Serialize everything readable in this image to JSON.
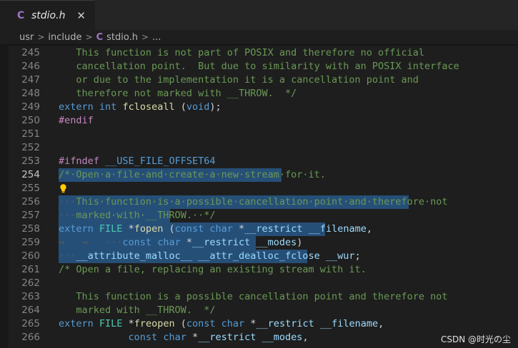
{
  "tab": {
    "icon": "c-file-icon",
    "icon_glyph": "C",
    "label": "stdio.h",
    "close_glyph": "✕"
  },
  "breadcrumb": {
    "parts": [
      "usr",
      "include",
      "stdio.h",
      "..."
    ],
    "sep": ">",
    "c_glyph": "C"
  },
  "watermark": "CSDN @时光の尘",
  "lines": [
    {
      "n": "245",
      "segs": [
        {
          "c": "cmt",
          "t": "   This function is not part of POSIX and therefore no official"
        }
      ]
    },
    {
      "n": "246",
      "segs": [
        {
          "c": "cmt",
          "t": "   cancellation point.  But due to similarity with an POSIX interface"
        }
      ]
    },
    {
      "n": "247",
      "segs": [
        {
          "c": "cmt",
          "t": "   or due to the implementation it is a cancellation point and"
        }
      ]
    },
    {
      "n": "248",
      "segs": [
        {
          "c": "cmt",
          "t": "   therefore not marked with __THROW.  */"
        }
      ]
    },
    {
      "n": "249",
      "segs": [
        {
          "c": "kw",
          "t": "extern"
        },
        {
          "c": "pl",
          "t": " "
        },
        {
          "c": "kw",
          "t": "int"
        },
        {
          "c": "pl",
          "t": " "
        },
        {
          "c": "fn",
          "t": "fcloseall"
        },
        {
          "c": "pl",
          "t": " ("
        },
        {
          "c": "kw",
          "t": "void"
        },
        {
          "c": "pl",
          "t": ");"
        }
      ]
    },
    {
      "n": "250",
      "segs": [
        {
          "c": "pp",
          "t": "#endif"
        }
      ]
    },
    {
      "n": "251",
      "segs": []
    },
    {
      "n": "252",
      "segs": []
    },
    {
      "n": "253",
      "segs": [
        {
          "c": "pp",
          "t": "#ifndef"
        },
        {
          "c": "pl",
          "t": " "
        },
        {
          "c": "mac",
          "t": "__USE_FILE_OFFSET64"
        }
      ]
    },
    {
      "n": "254",
      "active": true,
      "sel": 394,
      "segs": [
        {
          "c": "cmt",
          "t": "/*·Open·a·file·and·create·a·new·stream·for·it."
        }
      ]
    },
    {
      "n": "255",
      "bulb": true,
      "segs": []
    },
    {
      "n": "256",
      "sel": 572,
      "segs": [
        {
          "c": "ws",
          "t": "···"
        },
        {
          "c": "cmt",
          "t": "This·function·is·a·possible·cancellation·point·and·therefore·not"
        }
      ]
    },
    {
      "n": "257",
      "sel": 238,
      "segs": [
        {
          "c": "ws",
          "t": "···"
        },
        {
          "c": "cmt",
          "t": "marked·with·__THROW.··*/"
        }
      ]
    },
    {
      "n": "258",
      "sel": 455,
      "segs": [
        {
          "c": "kw",
          "t": "extern"
        },
        {
          "c": "pl",
          "t": " "
        },
        {
          "c": "ty",
          "t": "FILE"
        },
        {
          "c": "pl",
          "t": " *"
        },
        {
          "c": "fn",
          "t": "fopen"
        },
        {
          "c": "pl",
          "t": " ("
        },
        {
          "c": "kw",
          "t": "const"
        },
        {
          "c": "pl",
          "t": " "
        },
        {
          "c": "kw",
          "t": "char"
        },
        {
          "c": "pl",
          "t": " *"
        },
        {
          "c": "var",
          "t": "__restrict"
        },
        {
          "c": "pl",
          "t": " "
        },
        {
          "c": "var",
          "t": "__filename"
        },
        {
          "c": "pl",
          "t": ","
        }
      ]
    },
    {
      "n": "259",
      "sel": 358,
      "segs": [
        {
          "c": "ws",
          "t": "→   →   ···"
        },
        {
          "c": "kw",
          "t": "const"
        },
        {
          "c": "pl",
          "t": " "
        },
        {
          "c": "kw",
          "t": "char"
        },
        {
          "c": "pl",
          "t": " *"
        },
        {
          "c": "var",
          "t": "__restrict"
        },
        {
          "c": "pl",
          "t": " "
        },
        {
          "c": "var",
          "t": "__modes"
        },
        {
          "c": "pl",
          "t": ")"
        }
      ]
    },
    {
      "n": "260",
      "sel": 430,
      "segs": [
        {
          "c": "ws",
          "t": "···"
        },
        {
          "c": "var",
          "t": "__attribute_malloc__"
        },
        {
          "c": "pl",
          "t": " "
        },
        {
          "c": "var",
          "t": "__attr_dealloc_fclose"
        },
        {
          "c": "pl",
          "t": " "
        },
        {
          "c": "var",
          "t": "__wur"
        },
        {
          "c": "pl",
          "t": ";"
        }
      ]
    },
    {
      "n": "261",
      "segs": [
        {
          "c": "cmt",
          "t": "/* Open a file, replacing an existing stream with it."
        }
      ]
    },
    {
      "n": "262",
      "segs": []
    },
    {
      "n": "263",
      "segs": [
        {
          "c": "cmt",
          "t": "   This function is a possible cancellation point and therefore not"
        }
      ]
    },
    {
      "n": "264",
      "segs": [
        {
          "c": "cmt",
          "t": "   marked with __THROW.  */"
        }
      ]
    },
    {
      "n": "265",
      "segs": [
        {
          "c": "kw",
          "t": "extern"
        },
        {
          "c": "pl",
          "t": " "
        },
        {
          "c": "ty",
          "t": "FILE"
        },
        {
          "c": "pl",
          "t": " *"
        },
        {
          "c": "fn",
          "t": "freopen"
        },
        {
          "c": "pl",
          "t": " ("
        },
        {
          "c": "kw",
          "t": "const"
        },
        {
          "c": "pl",
          "t": " "
        },
        {
          "c": "kw",
          "t": "char"
        },
        {
          "c": "pl",
          "t": " *"
        },
        {
          "c": "var",
          "t": "__restrict"
        },
        {
          "c": "pl",
          "t": " "
        },
        {
          "c": "var",
          "t": "__filename"
        },
        {
          "c": "pl",
          "t": ","
        }
      ]
    },
    {
      "n": "266",
      "segs": [
        {
          "c": "pl",
          "t": "            "
        },
        {
          "c": "kw",
          "t": "const"
        },
        {
          "c": "pl",
          "t": " "
        },
        {
          "c": "kw",
          "t": "char"
        },
        {
          "c": "pl",
          "t": " *"
        },
        {
          "c": "var",
          "t": "__restrict"
        },
        {
          "c": "pl",
          "t": " "
        },
        {
          "c": "var",
          "t": "__modes"
        },
        {
          "c": "pl",
          "t": ","
        }
      ]
    }
  ]
}
